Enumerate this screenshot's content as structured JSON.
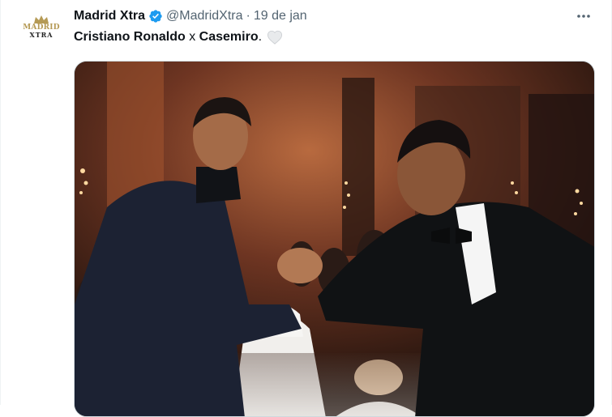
{
  "account": {
    "display_name": "Madrid Xtra",
    "handle": "@MadridXtra",
    "separator": "·",
    "date": "19 de jan",
    "avatar_text_line1": "MADRID",
    "avatar_text_line2": "XTRA"
  },
  "tweet": {
    "text_part1": "Cristiano Ronaldo",
    "text_part2": " x ",
    "text_part3": "Casemiro",
    "text_part4": ".",
    "emoji": "white-heart"
  },
  "icons": {
    "verified": "verified-badge-icon",
    "more": "more-options-icon"
  },
  "colors": {
    "verified_blue": "#1d9bf0",
    "text_primary": "#0f1419",
    "text_secondary": "#536471"
  }
}
